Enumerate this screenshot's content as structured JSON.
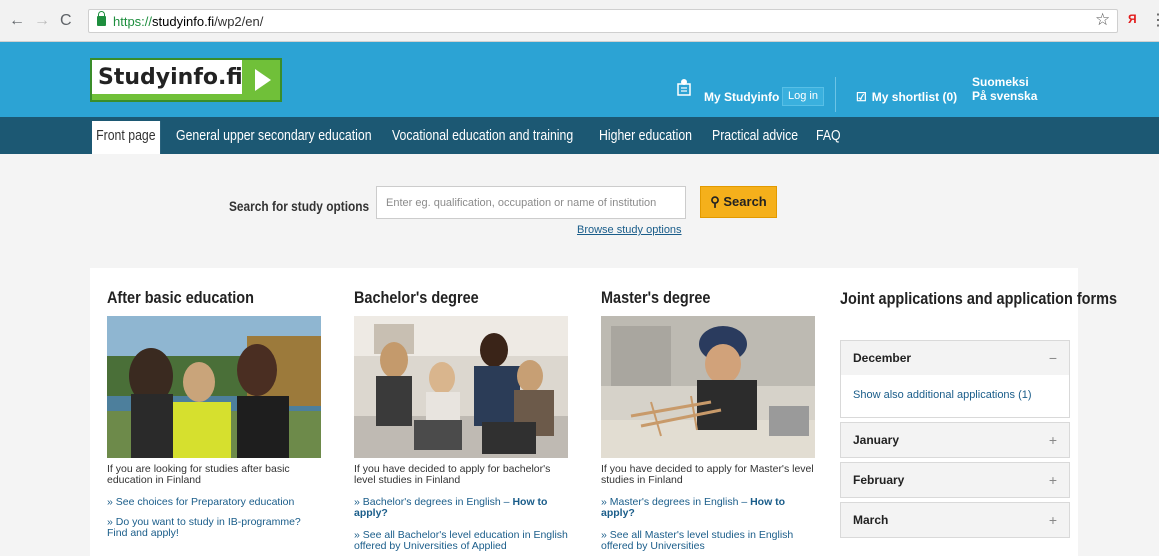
{
  "browser": {
    "url_scheme": "https://",
    "url_host": "studyinfo.fi",
    "url_path": "/wp2/en/",
    "extension_label": "Я"
  },
  "header": {
    "logo_text": "Studyinfo.fi",
    "my_studyinfo": "My Studyinfo",
    "login": "Log in",
    "shortlist": "My shortlist (0)",
    "lang_fi": "Suomeksi",
    "lang_sv": "På svenska"
  },
  "nav": {
    "items": [
      "Front page",
      "General upper secondary education",
      "Vocational education and training",
      "Higher education",
      "Practical advice",
      "FAQ"
    ]
  },
  "search": {
    "label": "Search for study options",
    "placeholder": "Enter eg. qualification, occupation or name of institution",
    "button": "Search",
    "browse": "Browse study options"
  },
  "columns": [
    {
      "title": "After basic education",
      "desc": "If you are looking for studies after basic education in Finland",
      "link1": "» See choices for Preparatory education",
      "link2": "» Do you want to study in IB-programme? Find and apply!"
    },
    {
      "title": "Bachelor's degree",
      "desc": "If you have decided to apply for bachelor's level studies in Finland",
      "link1_text": "» Bachelor's degrees in English –",
      "link1_bold": "How to apply?",
      "link2": "» See all Bachelor's level education in English offered by Universities of Applied"
    },
    {
      "title": "Master's degree",
      "desc": "If you have decided to apply for Master's level studies in Finland",
      "link1_text": "» Master's degrees in English –",
      "link1_bold": "How to apply?",
      "link2": "» See all Master's level studies in English offered by Universities"
    }
  ],
  "joint": {
    "title": "Joint applications and application forms",
    "months": [
      {
        "name": "December",
        "sign": "−",
        "expanded": true,
        "body": "Show also additional applications (1)"
      },
      {
        "name": "January",
        "sign": "+"
      },
      {
        "name": "February",
        "sign": "+"
      },
      {
        "name": "March",
        "sign": "+"
      }
    ]
  },
  "colors": {
    "header_bg": "#2ca3d4",
    "nav_bg": "#1c5873",
    "search_btn": "#f5b01b",
    "logo_green": "#70c039",
    "link": "#1a5d8a"
  }
}
